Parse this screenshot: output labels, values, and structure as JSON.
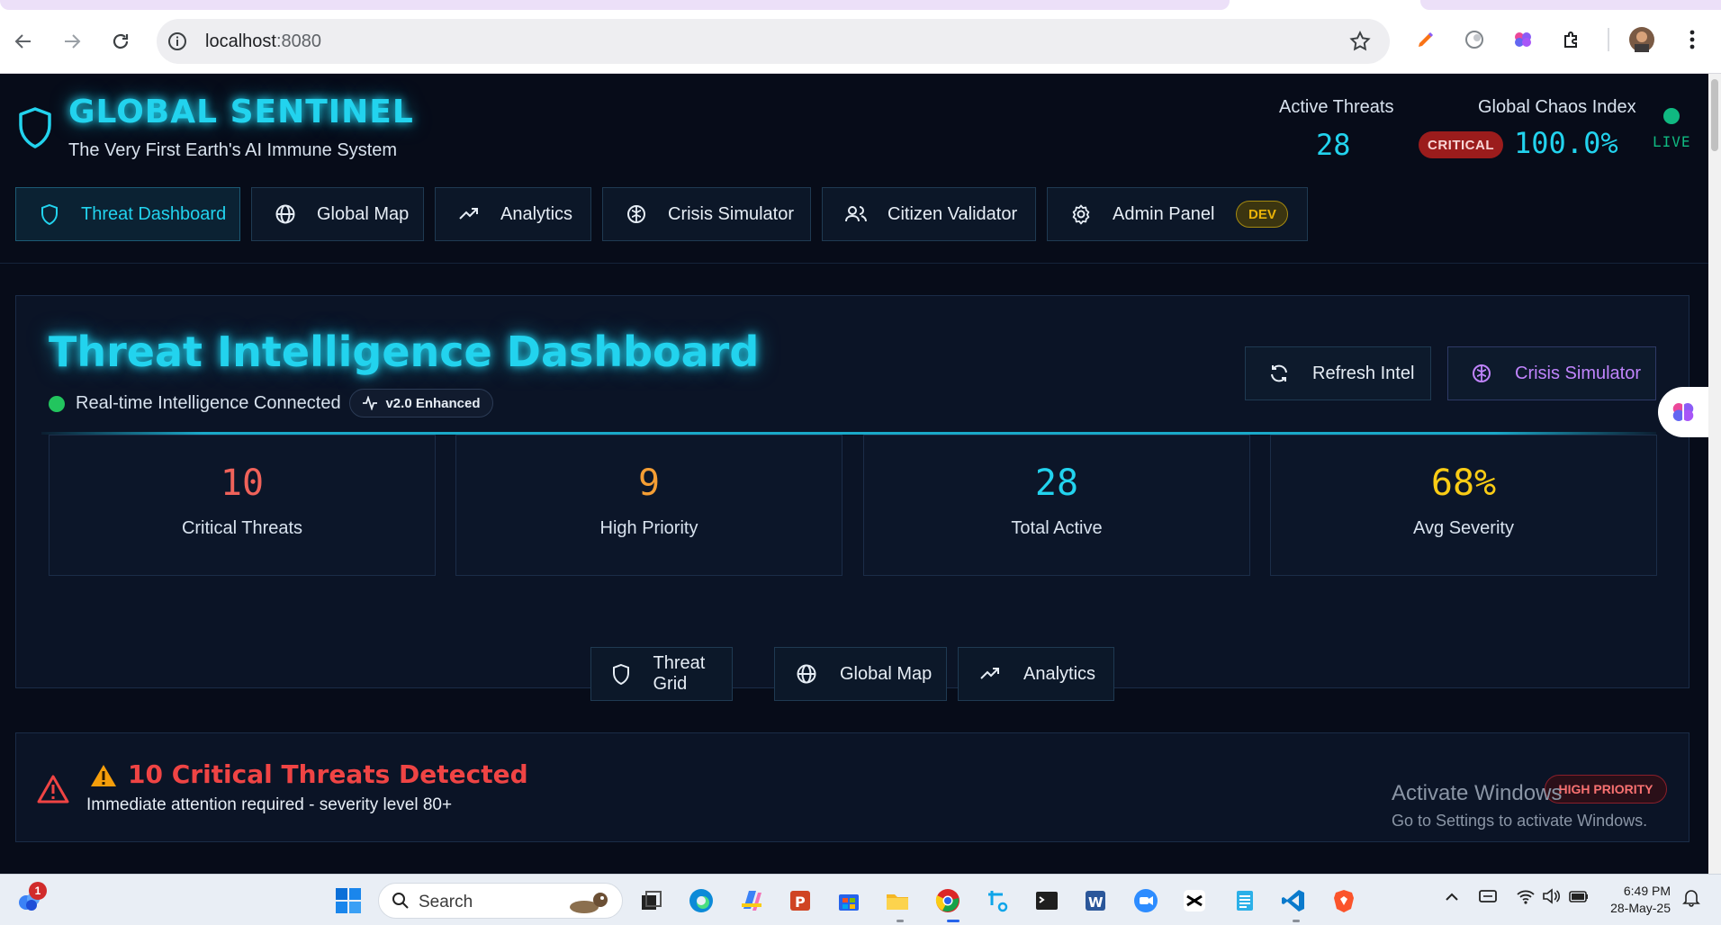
{
  "browser": {
    "url_host": "localhost",
    "url_port": ":8080"
  },
  "header": {
    "title": "GLOBAL SENTINEL",
    "subtitle": "The Very First Earth's AI Immune System",
    "active_threats_label": "Active Threats",
    "active_threats_value": "28",
    "chaos_label": "Global Chaos Index",
    "chaos_status": "CRITICAL",
    "chaos_value": "100.0%",
    "live_label": "LIVE"
  },
  "nav": {
    "items": [
      {
        "label": "Threat Dashboard",
        "icon": "shield-icon",
        "active": true
      },
      {
        "label": "Global Map",
        "icon": "globe-icon"
      },
      {
        "label": "Analytics",
        "icon": "trending-up-icon"
      },
      {
        "label": "Crisis Simulator",
        "icon": "brain-icon"
      },
      {
        "label": "Citizen Validator",
        "icon": "users-icon"
      },
      {
        "label": "Admin Panel",
        "icon": "gear-icon",
        "badge": "DEV"
      }
    ]
  },
  "dashboard": {
    "title": "Threat Intelligence Dashboard",
    "connection_status": "Real-time Intelligence Connected",
    "version_badge": "v2.0 Enhanced",
    "refresh_label": "Refresh Intel",
    "simulator_label": "Crisis Simulator",
    "metrics": [
      {
        "value": "10",
        "label": "Critical Threats",
        "color": "#f0625a"
      },
      {
        "value": "9",
        "label": "High Priority",
        "color": "#f59e34"
      },
      {
        "value": "28",
        "label": "Total Active",
        "color": "#22d3ee"
      },
      {
        "value": "68%",
        "label": "Avg Severity",
        "color": "#facc15"
      }
    ]
  },
  "view_tabs": [
    {
      "label": "Threat Grid",
      "icon": "shield-icon"
    },
    {
      "label": "Global Map",
      "icon": "globe-icon"
    },
    {
      "label": "Analytics",
      "icon": "trending-up-icon"
    }
  ],
  "alert": {
    "title": "10 Critical Threats Detected",
    "subtitle": "Immediate attention required - severity level 80+",
    "badge": "HIGH PRIORITY"
  },
  "watermark": {
    "line1": "Activate Windows",
    "line2": "Go to Settings to activate Windows."
  },
  "taskbar": {
    "search_label": "Search",
    "notification_count": "1",
    "time": "6:49 PM",
    "date": "28-May-25"
  },
  "colors": {
    "accent": "#22d3ee",
    "critical": "#ef4444",
    "live": "#10b981",
    "dev_badge": "#eab308"
  }
}
